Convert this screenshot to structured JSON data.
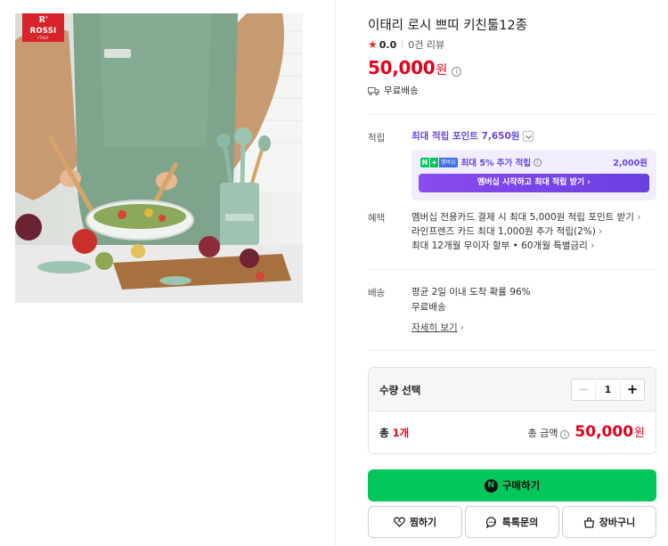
{
  "brand": {
    "logo_mark": "R'",
    "logo_name": "ROSSI",
    "logo_sub": "ITALY"
  },
  "product": {
    "title": "이태리 로시 쁘띠 키친툴12종",
    "rating": "0.0",
    "review_count": "0건 리뷰",
    "price": "50,000",
    "price_unit": "원",
    "shipping": "무료배송"
  },
  "points": {
    "label": "적립",
    "max_points": "최대 적립 포인트 7,650원",
    "membership": {
      "badge_n": "N",
      "badge_plus": "+",
      "badge_tag": "멤버십",
      "extra": "최대 5% 추가 적립",
      "points": "2,000원",
      "button": "멤버십 시작하고 최대 적립 받기 ›"
    }
  },
  "benefits": {
    "label": "혜택",
    "items": [
      "멤버십 전용카드 결제 시 최대 5,000원 적립 포인트 받기",
      "라인프렌즈 카드 최대 1,000원 추가 적립(2%)",
      "최대 12개월 무이자 할부 • 60개월 특별금리"
    ]
  },
  "delivery": {
    "label": "배송",
    "lines": [
      "평균 2일 이내 도착 확률 96%",
      "무료배송"
    ],
    "detail_link": "자세히 보기"
  },
  "quantity": {
    "label": "수량 선택",
    "minus": "−",
    "value": "1",
    "plus": "+",
    "total_prefix": "총",
    "total_count": "1개",
    "total_label": "총 금액",
    "total_amount": "50,000",
    "total_unit": "원"
  },
  "actions": {
    "buy_icon": "N",
    "buy": "구매하기",
    "wish": "찜하기",
    "talk": "톡톡문의",
    "cart": "장바구니"
  },
  "colors": {
    "price_red": "#e5001b",
    "naver_green": "#03c75a",
    "membership_purple": "#6a44d8"
  }
}
